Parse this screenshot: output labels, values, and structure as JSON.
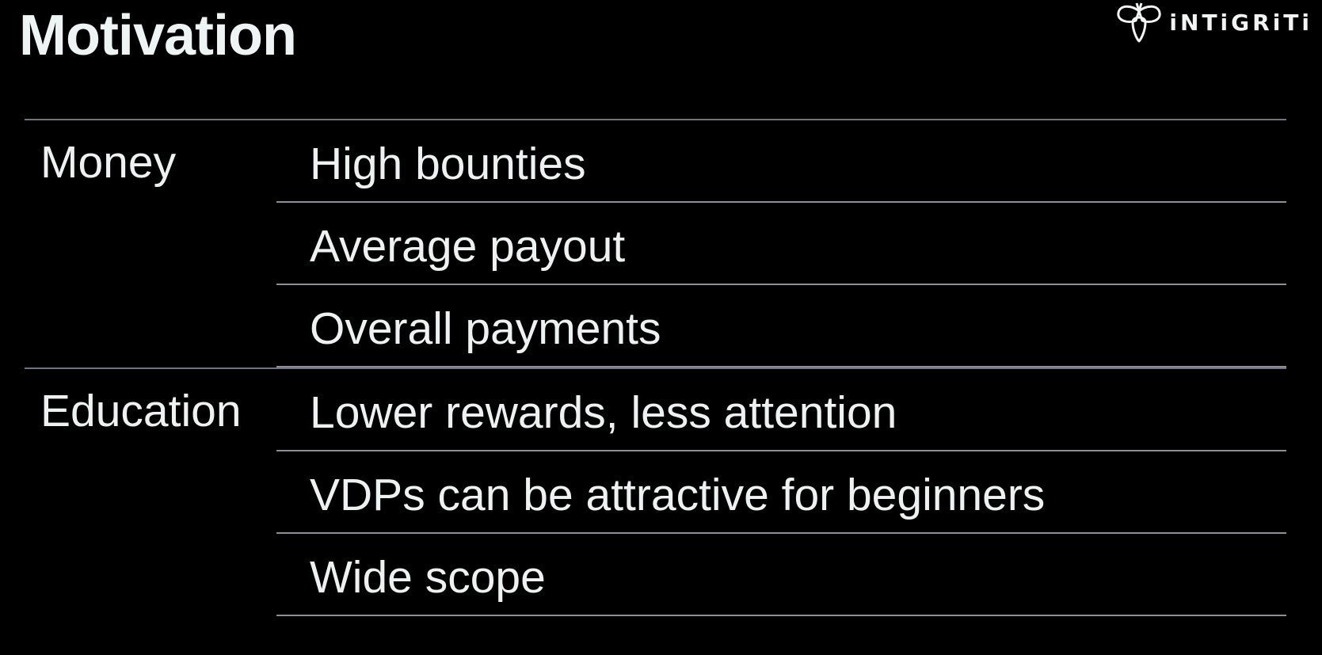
{
  "slide": {
    "title": "Motivation",
    "brand": "iNTiGRiTi"
  },
  "table": {
    "groups": [
      {
        "label": "Money",
        "items": [
          "High bounties",
          "Average payout",
          "Overall payments"
        ]
      },
      {
        "label": "Education",
        "items": [
          "Lower rewards, less attention",
          "VDPs can be attractive for beginners",
          "Wide scope"
        ]
      }
    ]
  },
  "colors": {
    "background": "#000000",
    "text": "#eef1f2",
    "rule": "#8d8f97"
  }
}
